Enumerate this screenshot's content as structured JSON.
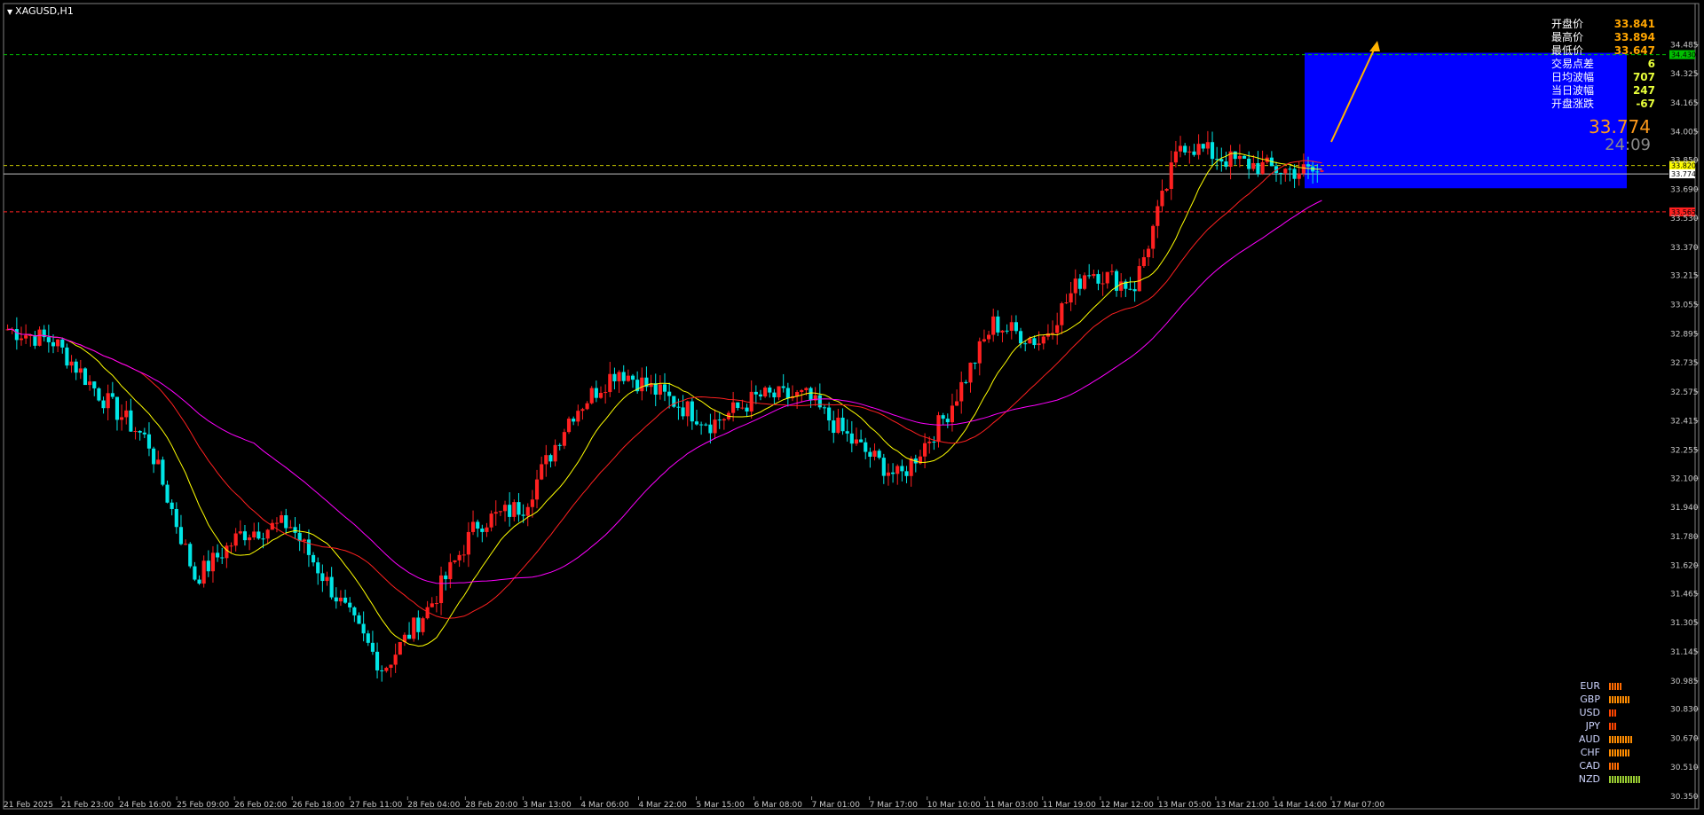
{
  "window": {
    "symbol_title": "XAGUSD,H1"
  },
  "info_panel": [
    {
      "label": "开盘价",
      "value": "33.841",
      "color": "#ffa500"
    },
    {
      "label": "最高价",
      "value": "33.894",
      "color": "#ffa500"
    },
    {
      "label": "最低价",
      "value": "33.647",
      "color": "#ffa500"
    },
    {
      "label": "交易点差",
      "value": "6",
      "color": "#e8ff3a"
    },
    {
      "label": "日均波幅",
      "value": "707",
      "color": "#e8ff3a"
    },
    {
      "label": "当日波幅",
      "value": "247",
      "color": "#e8ff3a"
    },
    {
      "label": "开盘涨跌",
      "value": "-67",
      "color": "#e8ff3a"
    }
  ],
  "current_price": {
    "price": "33.774",
    "countdown": "24:09"
  },
  "currency_strength": [
    {
      "name": "EUR",
      "bars": 5,
      "color": "#ff6a00"
    },
    {
      "name": "GBP",
      "bars": 8,
      "color": "#ff8c00"
    },
    {
      "name": "USD",
      "bars": 3,
      "color": "#ff4500"
    },
    {
      "name": "JPY",
      "bars": 3,
      "color": "#ff4500"
    },
    {
      "name": "AUD",
      "bars": 9,
      "color": "#ff8c00"
    },
    {
      "name": "CHF",
      "bars": 8,
      "color": "#ff8c00"
    },
    {
      "name": "CAD",
      "bars": 4,
      "color": "#ff6a00"
    },
    {
      "name": "NZD",
      "bars": 12,
      "color": "#9acd32"
    }
  ],
  "chart_data": {
    "type": "candlestick",
    "symbol": "XAGUSD",
    "timeframe": "H1",
    "ylim": [
      30.35,
      34.55
    ],
    "y_ticks": [
      34.485,
      34.325,
      34.165,
      34.005,
      33.85,
      33.69,
      33.53,
      33.37,
      33.215,
      33.055,
      32.895,
      32.735,
      32.575,
      32.415,
      32.255,
      32.1,
      31.94,
      31.78,
      31.62,
      31.465,
      31.305,
      31.145,
      30.985,
      30.83,
      30.67,
      30.51,
      30.35
    ],
    "y_ticks_labels": [
      "34.485",
      "34.325",
      "34.165",
      "34.005",
      "33.850",
      "33.690",
      "33.530",
      "33.370",
      "33.215",
      "33.055",
      "32.895",
      "32.735",
      "32.575",
      "32.415",
      "32.255",
      "32.100",
      "31.940",
      "31.780",
      "31.620",
      "31.465",
      "31.305",
      "31.145",
      "30.985",
      "30.830",
      "30.670",
      "30.510",
      "30.350"
    ],
    "x_labels": [
      "21 Feb 2025",
      "21 Feb 23:00",
      "24 Feb 16:00",
      "25 Feb 09:00",
      "26 Feb 02:00",
      "26 Feb 18:00",
      "27 Feb 11:00",
      "28 Feb 04:00",
      "28 Feb 20:00",
      "3 Mar 13:00",
      "4 Mar 06:00",
      "4 Mar 22:00",
      "5 Mar 15:00",
      "6 Mar 08:00",
      "7 Mar 01:00",
      "7 Mar 17:00",
      "10 Mar 10:00",
      "11 Mar 03:00",
      "11 Mar 19:00",
      "12 Mar 12:00",
      "13 Mar 05:00",
      "13 Mar 21:00",
      "14 Mar 14:00",
      "17 Mar 07:00"
    ],
    "series_profile": {
      "close_waypoints": [
        32.92,
        32.85,
        32.55,
        32.3,
        31.55,
        31.8,
        31.85,
        31.45,
        31.05,
        31.4,
        31.85,
        31.95,
        32.45,
        32.7,
        32.55,
        32.4,
        32.55,
        32.55,
        32.3,
        32.1,
        32.45,
        32.95,
        32.85,
        33.25,
        33.15,
        33.95,
        33.85,
        33.8,
        33.78
      ],
      "candle_count": 289
    },
    "moving_averages": [
      {
        "color": "#ffff00"
      },
      {
        "color": "#ff2020"
      },
      {
        "color": "#ff00ff"
      }
    ],
    "horizontal_levels": [
      {
        "price": 34.43,
        "style": "dashed",
        "color": "#00c000",
        "label": "34.430"
      },
      {
        "price": 33.82,
        "style": "dashed",
        "color": "#c8c800",
        "label": "33.820"
      },
      {
        "price": 33.774,
        "style": "solid",
        "color": "#c0c0c0",
        "label": "33.774"
      },
      {
        "price": 33.565,
        "style": "dashed",
        "color": "#ff2020",
        "label": "33.565"
      }
    ],
    "target_box": {
      "price_top": 34.44,
      "price_bottom": 33.695,
      "color": "#0000ff"
    }
  }
}
